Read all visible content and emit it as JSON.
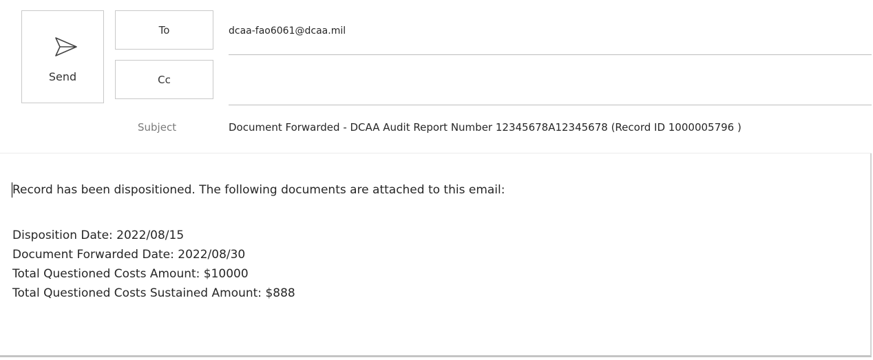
{
  "compose": {
    "send_label": "Send",
    "to_label": "To",
    "cc_label": "Cc",
    "to_value": "dcaa-fao6061@dcaa.mil",
    "cc_value": "",
    "subject_label": "Subject",
    "subject_value": "Document Forwarded - DCAA Audit Report Number 12345678A12345678 (Record ID 1000005796 )"
  },
  "body": {
    "intro": "Record has been dispositioned. The following documents are attached to this email:",
    "disposition_date": "Disposition Date: 2022/08/15",
    "forwarded_date": "Document Forwarded Date: 2022/08/30",
    "questioned_amount": "Total Questioned Costs Amount: $10000",
    "sustained_amount": "Total Questioned Costs Sustained Amount: $888"
  },
  "icons": {
    "send": "send-icon"
  }
}
